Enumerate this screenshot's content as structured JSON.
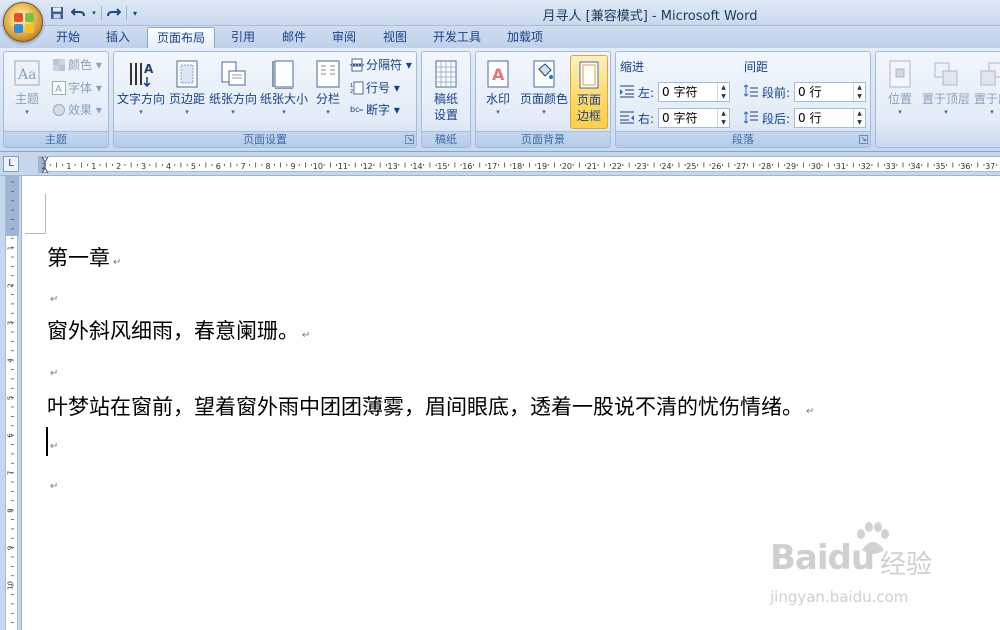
{
  "window": {
    "title": "月寻人 [兼容模式] - Microsoft Word"
  },
  "tabs": [
    {
      "label": "开始"
    },
    {
      "label": "插入"
    },
    {
      "label": "页面布局"
    },
    {
      "label": "引用"
    },
    {
      "label": "邮件"
    },
    {
      "label": "审阅"
    },
    {
      "label": "视图"
    },
    {
      "label": "开发工具"
    },
    {
      "label": "加载项"
    }
  ],
  "ribbon": {
    "theme": {
      "label": "主题",
      "themes_btn": "主题",
      "colors_btn": "颜色",
      "fonts_btn": "字体",
      "effects_btn": "效果"
    },
    "page_setup": {
      "label": "页面设置",
      "text_direction": "文字方向",
      "margins": "页边距",
      "orientation": "纸张方向",
      "size": "纸张大小",
      "columns": "分栏",
      "breaks": "分隔符",
      "line_numbers": "行号",
      "hyphenation": "断字"
    },
    "manuscript": {
      "label": "稿纸",
      "settings_line1": "稿纸",
      "settings_line2": "设置"
    },
    "page_background": {
      "label": "页面背景",
      "watermark": "水印",
      "page_color": "页面颜色",
      "page_borders_line1": "页面",
      "page_borders_line2": "边框"
    },
    "paragraph": {
      "label": "段落",
      "indent_title": "缩进",
      "spacing_title": "间距",
      "left_label": "左:",
      "left_value": "0 字符",
      "right_label": "右:",
      "right_value": "0 字符",
      "before_label": "段前:",
      "before_value": "0 行",
      "after_label": "段后:",
      "after_value": "0 行"
    },
    "arrange": {
      "position": "位置",
      "bring_front": "置于顶层",
      "send_back": "置于底"
    }
  },
  "ruler": {
    "corner": "L",
    "labels": [
      "2",
      "1",
      "1",
      "2",
      "3",
      "4",
      "5",
      "6",
      "7",
      "8",
      "9",
      "10",
      "11",
      "12",
      "13",
      "14",
      "15",
      "16",
      "17",
      "18",
      "19",
      "20",
      "21",
      "22",
      "23",
      "24",
      "25",
      "26",
      "27",
      "28",
      "29",
      "30",
      "31",
      "32",
      "33",
      "34",
      "35",
      "36",
      "37"
    ],
    "vlabels": [
      "1",
      "2",
      "3",
      "4",
      "5",
      "6",
      "7",
      "8",
      "9",
      "10"
    ]
  },
  "document": {
    "lines": [
      {
        "text": "第一章",
        "mark": "↵"
      },
      {
        "text": "",
        "mark": "↵"
      },
      {
        "text": "窗外斜风细雨，春意阑珊。",
        "mark": "↵"
      },
      {
        "text": "",
        "mark": "↵"
      },
      {
        "text": "叶梦站在窗前，望着窗外雨中团团薄雾，眉间眼底，透着一股说不清的忧伤情绪。",
        "mark": "↵"
      },
      {
        "text": "",
        "mark": "↵"
      },
      {
        "text": "",
        "mark": "↵"
      }
    ]
  },
  "watermark": {
    "brand": "Baidu",
    "brand_cn": "经验",
    "url": "jingyan.baidu.com"
  }
}
